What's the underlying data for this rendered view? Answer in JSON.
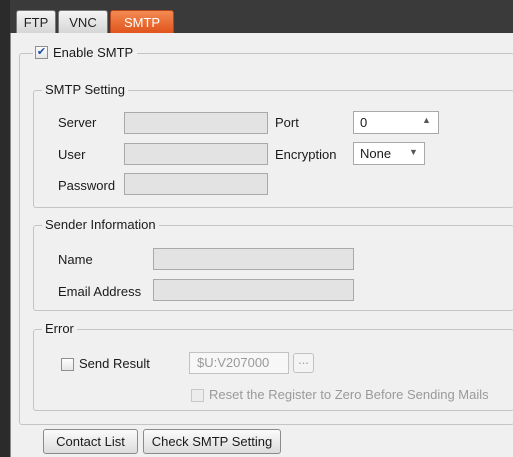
{
  "tabs": [
    {
      "label": "FTP",
      "active": false
    },
    {
      "label": "VNC",
      "active": false
    },
    {
      "label": "SMTP",
      "active": true
    }
  ],
  "colors": {
    "active_tab": "#e0541c",
    "background": "#f0f0f0",
    "dark_chrome": "#3a3a3a"
  },
  "enable_smtp": {
    "label": "Enable SMTP",
    "checked": true
  },
  "smtp_setting": {
    "title": "SMTP Setting",
    "server_label": "Server",
    "server_value": "",
    "user_label": "User",
    "user_value": "",
    "password_label": "Password",
    "password_value": "",
    "port_label": "Port",
    "port_value": "0",
    "encryption_label": "Encryption",
    "encryption_value": "None"
  },
  "sender": {
    "title": "Sender Information",
    "name_label": "Name",
    "name_value": "",
    "email_label": "Email Address",
    "email_value": ""
  },
  "error": {
    "title": "Error",
    "send_result_label": "Send Result",
    "send_result_checked": false,
    "register_value": "$U:V207000",
    "browse_label": "...",
    "reset_label": "Reset the Register to Zero Before Sending Mails",
    "reset_checked": false
  },
  "buttons": {
    "contact_list": "Contact List",
    "check_smtp": "Check SMTP Setting"
  }
}
